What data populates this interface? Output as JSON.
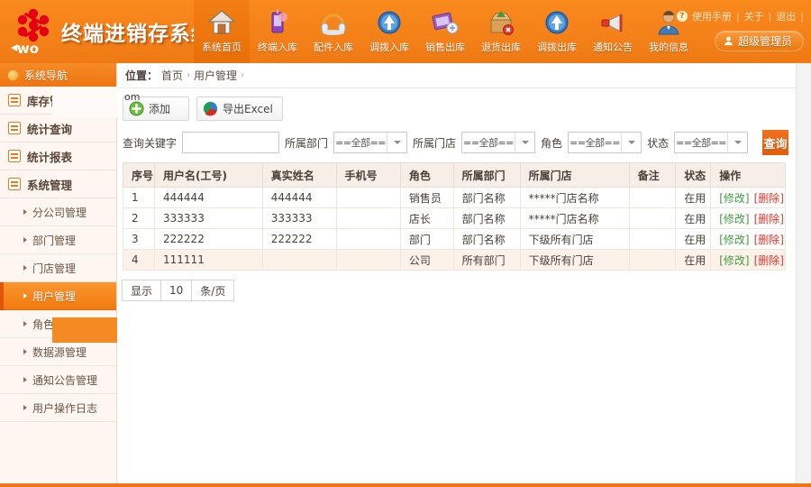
{
  "header": {
    "logo_title": "终端进销存系统",
    "logo_icon": "unicom-logo-icon",
    "nav": [
      {
        "label": "系统首页",
        "icon": "home-icon",
        "active": true
      },
      {
        "label": "终端入库",
        "icon": "phone-in-icon",
        "active": false
      },
      {
        "label": "配件入库",
        "icon": "headset-in-icon",
        "active": false
      },
      {
        "label": "调拨入库",
        "icon": "transfer-in-icon",
        "active": false
      },
      {
        "label": "销售出库",
        "icon": "sale-out-icon",
        "active": false
      },
      {
        "label": "退货出库",
        "icon": "return-out-icon",
        "active": false
      },
      {
        "label": "调拨出库",
        "icon": "transfer-out-icon",
        "active": false
      },
      {
        "label": "通知公告",
        "icon": "megaphone-icon",
        "active": false
      },
      {
        "label": "我的信息",
        "icon": "user-info-icon",
        "active": false
      }
    ],
    "top_links": [
      {
        "label": "使用手册",
        "icon": "question-icon"
      },
      {
        "label": "关于",
        "icon": ""
      },
      {
        "label": "退出",
        "icon": ""
      }
    ],
    "user_chip": {
      "label": "超级管理员",
      "icon": "user-icon"
    }
  },
  "sidebar": {
    "title": "系统导航",
    "title_icon": "bulb-icon",
    "groups": [
      {
        "label": "库存管理",
        "icon": "inventory-icon"
      },
      {
        "label": "统计查询",
        "icon": "query-icon"
      },
      {
        "label": "统计报表",
        "icon": "report-icon"
      },
      {
        "label": "系统管理",
        "icon": "system-icon"
      }
    ],
    "subitems": [
      {
        "label": "分公司管理",
        "active": false
      },
      {
        "label": "部门管理",
        "active": false
      },
      {
        "label": "门店管理",
        "active": false
      },
      {
        "label": "用户管理",
        "active": true
      },
      {
        "label": "角色权限管理",
        "active": false
      },
      {
        "label": "数据源管理",
        "active": false
      },
      {
        "label": "通知公告管理",
        "active": false
      },
      {
        "label": "用户操作日志",
        "active": false
      }
    ]
  },
  "breadcrumb": {
    "prefix": "位置：",
    "items": [
      "首页",
      "用户管理"
    ],
    "separator": "›"
  },
  "toolbar": {
    "artifact_text": "om",
    "buttons": [
      {
        "label": "添加",
        "icon": "add-green-plus-icon"
      },
      {
        "label": "导出Excel",
        "icon": "excel-pie-icon"
      }
    ]
  },
  "filters": {
    "keyword_label": "查询关键字",
    "keyword_value": "",
    "keyword_placeholder": "",
    "selects": [
      {
        "label": "所属部门",
        "value": "==全部=="
      },
      {
        "label": "所属门店",
        "value": "==全部=="
      },
      {
        "label": "角色",
        "value": "==全部=="
      },
      {
        "label": "状态",
        "value": "==全部=="
      }
    ],
    "search_label": "查询"
  },
  "table": {
    "columns": [
      "序号",
      "用户名(工号)",
      "真实姓名",
      "手机号",
      "角色",
      "所属部门",
      "所属门店",
      "备注",
      "状态",
      "操作"
    ],
    "rows": [
      {
        "no": "1",
        "username": "444444",
        "realname": "444444",
        "phone": "",
        "role": "销售员",
        "dept": "部门名称",
        "dept_red": false,
        "store": "*****门店名称",
        "store_red": false,
        "remark": "",
        "status": "在用",
        "edit": "[修改]",
        "del": "[删除]"
      },
      {
        "no": "2",
        "username": "333333",
        "realname": "333333",
        "phone": "",
        "role": "店长",
        "dept": "部门名称",
        "dept_red": false,
        "store": "*****门店名称",
        "store_red": false,
        "remark": "",
        "status": "在用",
        "edit": "[修改]",
        "del": "[删除]"
      },
      {
        "no": "3",
        "username": "222222",
        "realname": "222222",
        "phone": "",
        "role": "部门",
        "dept": "部门名称",
        "dept_red": false,
        "store": "下级所有门店",
        "store_red": true,
        "remark": "",
        "status": "在用",
        "edit": "[修改]",
        "del": "[删除]"
      },
      {
        "no": "4",
        "username": "111111",
        "realname": "",
        "phone": "",
        "role": "公司",
        "dept": "所有部门",
        "dept_red": true,
        "store": "下级所有门店",
        "store_red": true,
        "remark": "",
        "status": "在用",
        "edit": "[修改]",
        "del": "[删除]"
      }
    ]
  },
  "pager": {
    "prefix": "显示",
    "size": "10",
    "suffix": "条/页"
  },
  "colors": {
    "brand_orange": "#f2741a",
    "header_orange": "#f6821a",
    "active_sidebar": "#f07a10",
    "row_alt": "#fdf2ea",
    "danger_red": "#e2342b",
    "edit_green": "#3f9b3f"
  }
}
